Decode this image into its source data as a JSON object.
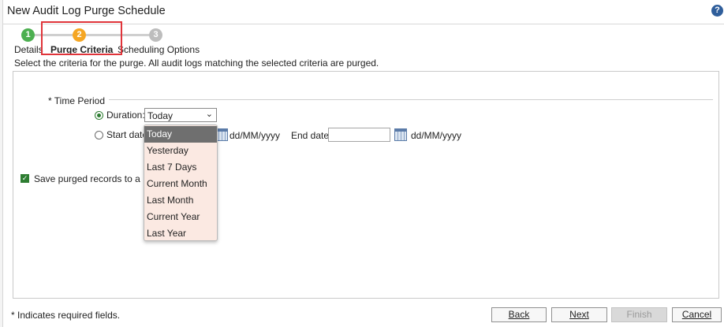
{
  "dialog": {
    "title": "New Audit Log Purge Schedule",
    "help_icon": "question-circle-icon",
    "help_glyph": "?"
  },
  "steps": [
    {
      "number": "1",
      "label": "Details",
      "color": "#4caf50"
    },
    {
      "number": "2",
      "label": "Purge Criteria",
      "color": "#f5a623",
      "current": true
    },
    {
      "number": "3",
      "label": "Scheduling Options",
      "color": "#bdbdbd"
    }
  ],
  "instructions": "Select the criteria for the purge. All audit logs matching the selected criteria are purged.",
  "time_period": {
    "section_title": "* Time Period",
    "duration_label": "Duration:",
    "duration_value": "Today",
    "start_date_label": "Start date",
    "start_date_format": "dd/MM/yyyy",
    "end_date_label": "End date:",
    "end_date_value": "",
    "end_date_format": "dd/MM/yyyy"
  },
  "duration_options": [
    "Today",
    "Yesterday",
    "Last 7 Days",
    "Current Month",
    "Last Month",
    "Current Year",
    "Last Year"
  ],
  "save_records": {
    "label": "Save purged records to a Do",
    "checked": true
  },
  "footer": {
    "required_note": "* Indicates required fields.",
    "back_label": "Back",
    "next_label": "Next",
    "finish_label": "Finish",
    "cancel_label": "Cancel"
  },
  "colors": {
    "accent_green": "#2e7d32",
    "highlight_red": "#e0343a",
    "dropdown_bg": "#fbe9e2",
    "dropdown_selected": "#6f6f6f"
  }
}
